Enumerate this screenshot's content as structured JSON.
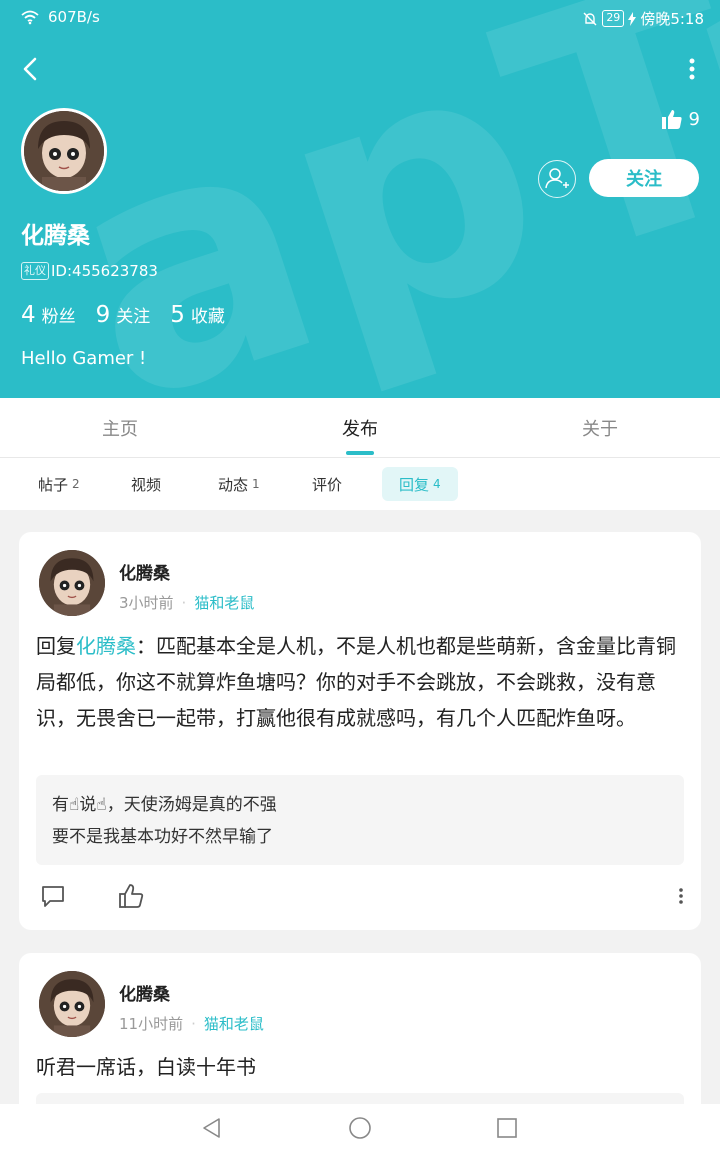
{
  "status_bar": {
    "net_speed": "607B/s",
    "battery": "29",
    "time": "傍晚5:18"
  },
  "header": {
    "watermark": "apTap",
    "likes": "9",
    "follow_label": "关注",
    "username": "化腾桑",
    "badge": "礼仪",
    "id_text": "ID:455623783",
    "stats": [
      {
        "num": "4",
        "label": "粉丝"
      },
      {
        "num": "9",
        "label": "关注"
      },
      {
        "num": "5",
        "label": "收藏"
      }
    ],
    "bio": "Hello Gamer !"
  },
  "tabs": [
    {
      "label": "主页",
      "active": false
    },
    {
      "label": "发布",
      "active": true
    },
    {
      "label": "关于",
      "active": false
    }
  ],
  "subtabs": [
    {
      "label": "帖子",
      "count": "2",
      "active": false
    },
    {
      "label": "视频",
      "count": "",
      "active": false
    },
    {
      "label": "动态",
      "count": "1",
      "active": false
    },
    {
      "label": "评价",
      "count": "",
      "active": false
    },
    {
      "label": "回复",
      "count": "4",
      "active": true
    }
  ],
  "posts": [
    {
      "author": "化腾桑",
      "time": "3小时前",
      "game": "猫和老鼠",
      "reply_prefix": "回复",
      "mention": "化腾桑",
      "body": "：匹配基本全是人机，不是人机也都是些萌新，含金量比青铜局都低，你这不就算炸鱼塘吗？你的对手不会跳放，不会跳救，没有意识，无畏舍已一起带，打赢他很有成就感吗，有几个人匹配炸鱼呀。",
      "quote_line1": "有☝说☝，天使汤姆是真的不强",
      "quote_line2": "要不是我基本功好不然早输了"
    },
    {
      "author": "化腾桑",
      "time": "11小时前",
      "game": "猫和老鼠",
      "body": "听君一席话，白读十年书"
    }
  ],
  "colors": {
    "accent": "#2bbdc8",
    "header_bg": "#2bbdc8",
    "page_bg": "#f2f2f2"
  }
}
